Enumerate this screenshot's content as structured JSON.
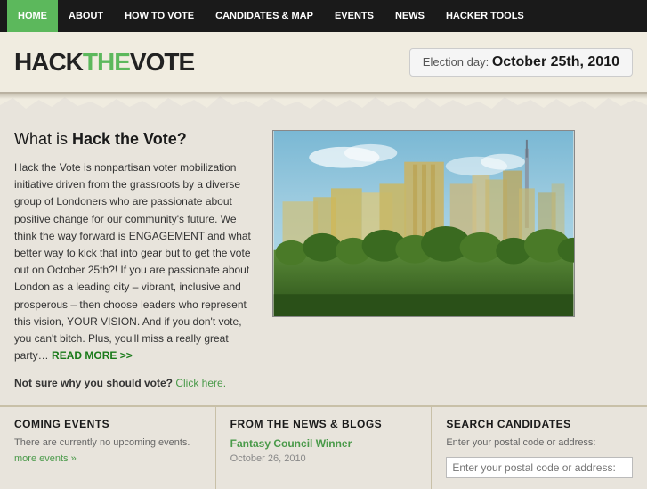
{
  "nav": {
    "items": [
      {
        "label": "HOME",
        "active": true
      },
      {
        "label": "ABOUT",
        "active": false
      },
      {
        "label": "HOW TO VOTE",
        "active": false
      },
      {
        "label": "CANDIDATES & MAP",
        "active": false
      },
      {
        "label": "EVENTS",
        "active": false
      },
      {
        "label": "NEWS",
        "active": false
      },
      {
        "label": "HACKER TOOLS",
        "active": false
      }
    ]
  },
  "header": {
    "logo": {
      "hack": "HACK",
      "the": "THE",
      "vote": "VOTE"
    },
    "election_prefix": "Election day: ",
    "election_date": "October 25th, 2010"
  },
  "main": {
    "title_normal": "What is ",
    "title_bold": "Hack the Vote?",
    "body_text": "Hack the Vote is nonpartisan voter mobilization initiative driven from the grassroots by a diverse group of Londoners who are passionate about positive change for our community's future. We think the way forward is ENGAGEMENT and what better way to kick that into gear but to get the vote out on October 25th?! If you are passionate about London as a leading city – vibrant, inclusive and prosperous – then choose leaders who represent this vision, YOUR VISION. And if you don't vote, you can't bitch. Plus, you'll miss a really great party…",
    "read_more": "READ MORE >>",
    "not_sure": "Not sure why you should vote?",
    "click_here": " Click here."
  },
  "bottom": {
    "events": {
      "title": "COMING EVENTS",
      "empty_text": "There are currently no upcoming events.",
      "more_label": "more events »"
    },
    "news": {
      "title": "FROM THE NEWS & BLOGS",
      "link_label": "Fantasy Council Winner",
      "date": "October 26, 2010"
    },
    "search": {
      "title": "SEARCH CANDIDATES",
      "placeholder_text": "Enter your postal code or address:"
    }
  }
}
